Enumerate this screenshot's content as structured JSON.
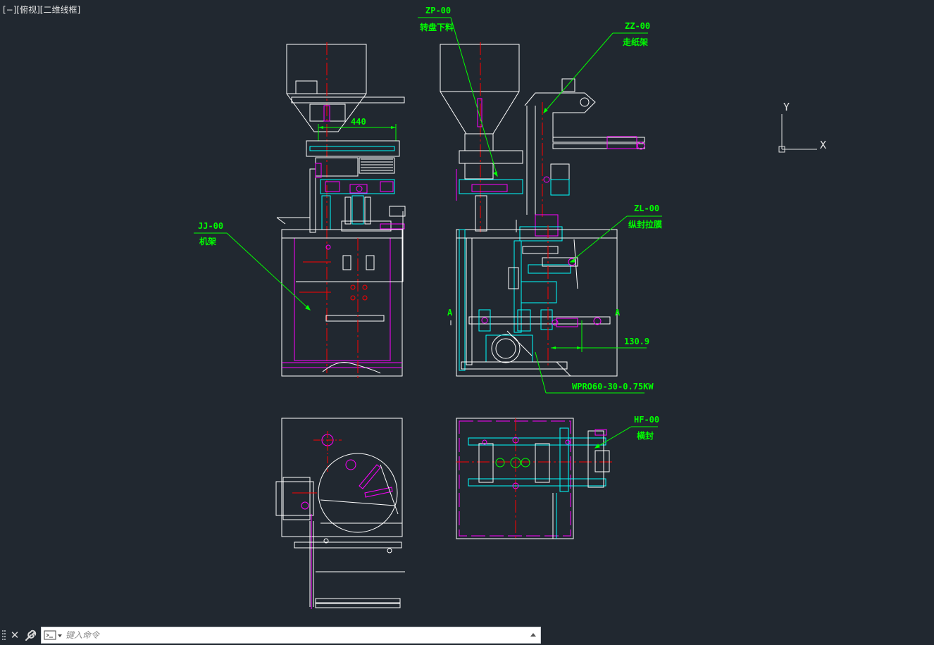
{
  "viewport": {
    "label": "[−][俯视][二维线框]",
    "background": "#212830"
  },
  "annotations": {
    "zp_code": "ZP-00",
    "zp_name": "转盘下料",
    "zz_code": "ZZ-00",
    "zz_name": "走纸架",
    "jj_code": "JJ-00",
    "jj_name": "机架",
    "zl_code": "ZL-00",
    "zl_name": "纵封拉膜",
    "hf_code": "HF-00",
    "hf_name": "横封",
    "motor": "WPRO60-30-0.75KW",
    "dim_width": "440",
    "dim_offset": "130.9",
    "section_left": "A",
    "section_right": "A"
  },
  "ucs": {
    "x_label": "X",
    "y_label": "Y"
  },
  "colors": {
    "line_white": "#ffffff",
    "cyan": "#00ffff",
    "magenta": "#ff00ff",
    "red": "#ff0000",
    "green": "#00ff00",
    "annotation": "#00ff00"
  },
  "command": {
    "placeholder": "键入命令",
    "value": ""
  }
}
